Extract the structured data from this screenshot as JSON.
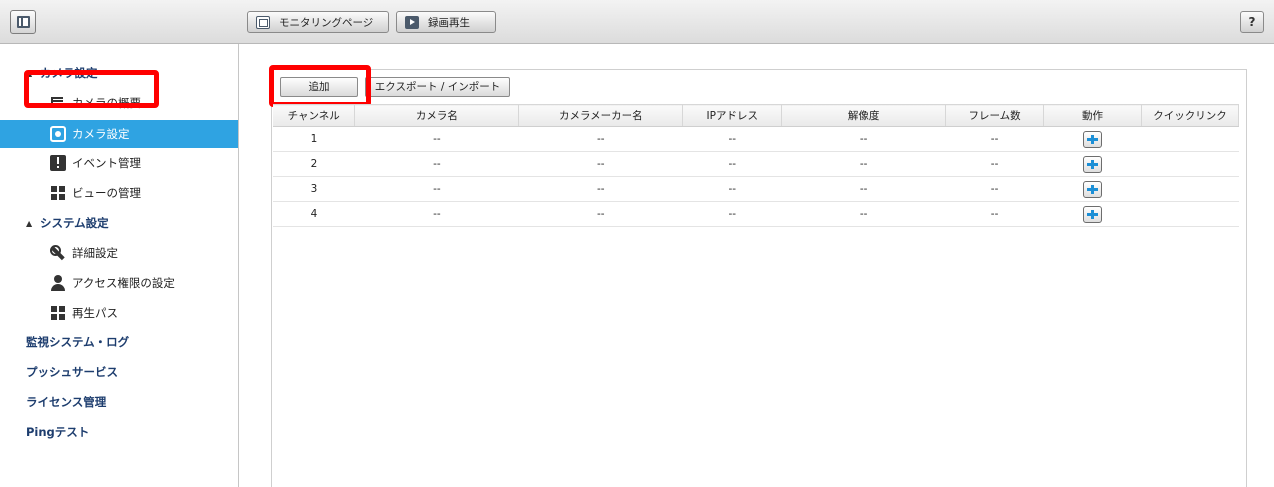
{
  "toolbar": {
    "monitoring_label": "モニタリングページ",
    "playback_label": "録画再生",
    "help_label": "?"
  },
  "sidebar": {
    "camera_settings_group": "カメラ設定",
    "camera_overview": "カメラの概要",
    "camera_settings": "カメラ設定",
    "event_management": "イベント管理",
    "view_management": "ビューの管理",
    "system_settings_group": "システム設定",
    "advanced_settings": "詳細設定",
    "access_rights": "アクセス権限の設定",
    "playback_path": "再生パス",
    "surveillance_log": "監視システム・ログ",
    "push_service": "プッシュサービス",
    "license_management": "ライセンス管理",
    "ping_test": "Pingテスト"
  },
  "actions": {
    "add_label": "追加",
    "export_import_label": "エクスポート / インポート"
  },
  "table": {
    "headers": [
      "チャンネル",
      "カメラ名",
      "カメラメーカー名",
      "IPアドレス",
      "解像度",
      "フレーム数",
      "動作",
      "クイックリンク"
    ],
    "rows": [
      {
        "channel": "1",
        "name": "--",
        "maker": "--",
        "ip": "--",
        "resolution": "--",
        "frames": "--"
      },
      {
        "channel": "2",
        "name": "--",
        "maker": "--",
        "ip": "--",
        "resolution": "--",
        "frames": "--"
      },
      {
        "channel": "3",
        "name": "--",
        "maker": "--",
        "ip": "--",
        "resolution": "--",
        "frames": "--"
      },
      {
        "channel": "4",
        "name": "--",
        "maker": "--",
        "ip": "--",
        "resolution": "--",
        "frames": "--"
      }
    ]
  },
  "colors": {
    "selected_bg": "#2fa3e2",
    "highlight_red": "#ff0000",
    "group_text": "#1d3d6e",
    "plus_blue": "#1c8fd6"
  }
}
